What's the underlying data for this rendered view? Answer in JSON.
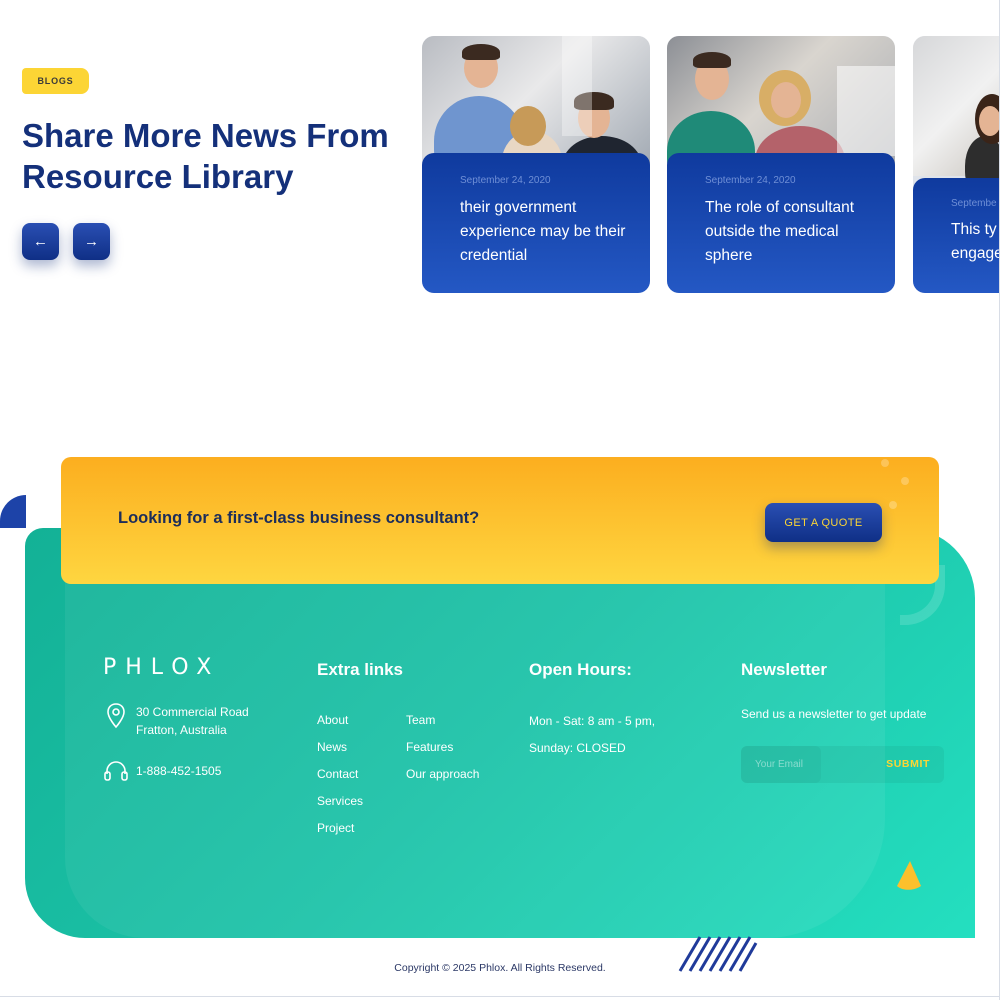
{
  "blogs": {
    "tag": "BLOGS",
    "title": "Share More News From Resource Library",
    "prev_icon": "arrow-left-icon",
    "next_icon": "arrow-right-icon",
    "prev_glyph": "←",
    "next_glyph": "→",
    "cards": [
      {
        "date": "September 24, 2020",
        "title": "their government experience may be their credential"
      },
      {
        "date": "September 24, 2020",
        "title": "The role of consultant outside the medical sphere"
      },
      {
        "date": "Septembe",
        "title_line1": "This ty",
        "title_line2": "engage"
      }
    ]
  },
  "cta": {
    "text": "Looking for a first-class business consultant?",
    "button": "GET A QUOTE"
  },
  "footer": {
    "logo": "PHLOX",
    "address_line1": "30 Commercial Road",
    "address_line2": "Fratton, Australia",
    "address_icon": "location-pin-icon",
    "phone": "1-888-452-1505",
    "phone_icon": "headphones-icon",
    "extra_links_title": "Extra links",
    "links_col1": [
      "About",
      "News",
      "Contact",
      "Services",
      "Project"
    ],
    "links_col2": [
      "Team",
      "Features",
      "Our approach"
    ],
    "hours_title": "Open Hours:",
    "hours": [
      "Mon - Sat: 8 am - 5 pm,",
      "Sunday: CLOSED"
    ],
    "newsletter_title": "Newsletter",
    "newsletter_text": "Send us a newsletter to get update",
    "email_placeholder": "Your Email",
    "submit": "SUBMIT",
    "copyright": "Copyright © 2025 Phlox. All Rights Reserved."
  },
  "colors": {
    "brand_navy": "#14307a",
    "accent_yellow": "#fcd535",
    "footer_teal": "#1cc3a8",
    "card_blue": "#1a47b0"
  }
}
